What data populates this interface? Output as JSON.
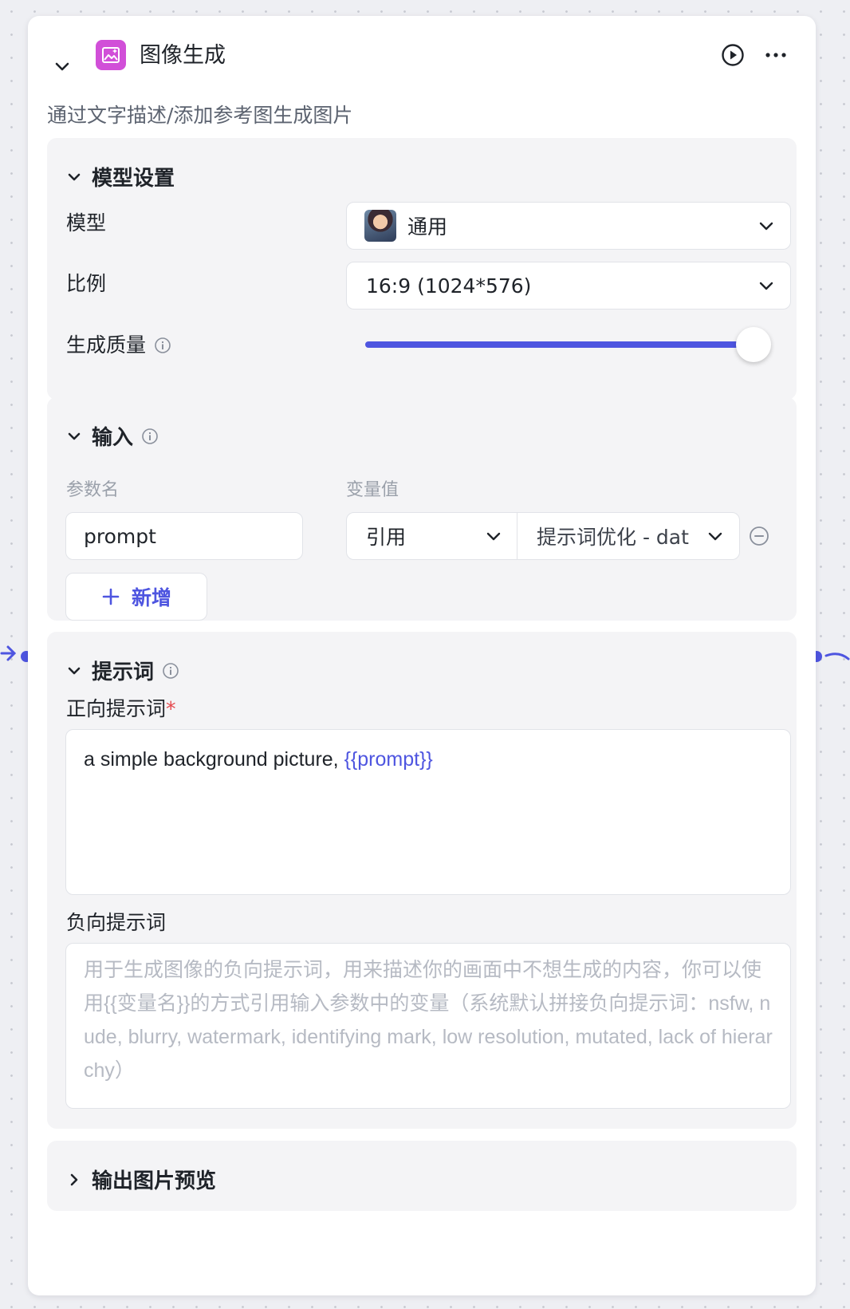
{
  "node": {
    "title": "图像生成",
    "description": "通过文字描述/添加参考图生成图片",
    "icon": "image-generate-icon",
    "accent_color": "#d14fd8"
  },
  "model_settings": {
    "title": "模型设置",
    "model_label": "模型",
    "model_value": "通用",
    "ratio_label": "比例",
    "ratio_value": "16:9 (1024*576)",
    "quality_label": "生成质量",
    "quality_level": 1.0
  },
  "input": {
    "title": "输入",
    "param_header": "参数名",
    "value_header": "变量值",
    "rows": [
      {
        "name": "prompt",
        "type": "引用",
        "ref": "提示词优化 - dat"
      }
    ],
    "add_label": "新增"
  },
  "prompt": {
    "title": "提示词",
    "positive_label": "正向提示词",
    "required_mark": "*",
    "positive_text": "a simple background picture, ",
    "positive_var": "{{prompt}}",
    "negative_label": "负向提示词",
    "negative_placeholder": "用于生成图像的负向提示词，用来描述你的画面中不想生成的内容，你可以使用{{变量名}}的方式引用输入参数中的变量（系统默认拼接负向提示词：nsfw, nude, blurry, watermark, identifying mark, low resolution, mutated, lack of hierarchy）"
  },
  "output": {
    "title": "输出图片预览"
  },
  "colors": {
    "accent": "#4e55e0",
    "section_bg": "#f4f4f6",
    "canvas_bg": "#eeeff3"
  }
}
